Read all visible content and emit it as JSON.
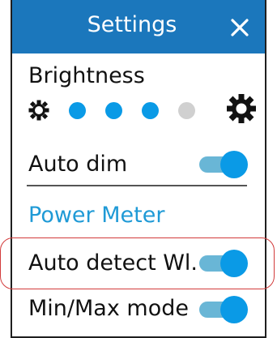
{
  "header": {
    "title": "Settings",
    "close_icon": "close-icon"
  },
  "brightness": {
    "label": "Brightness",
    "min_icon": "sun-small-icon",
    "max_icon": "sun-large-icon",
    "level": 3,
    "max_level": 4
  },
  "auto_dim": {
    "label": "Auto dim",
    "enabled": true
  },
  "section": {
    "power_meter": "Power Meter"
  },
  "auto_detect": {
    "label": "Auto detect Wl.",
    "enabled": true
  },
  "min_max": {
    "label": "Min/Max mode",
    "enabled": true
  },
  "colors": {
    "header_bg": "#1b77bc",
    "accent": "#1f9ad6",
    "toggle_track": "#69b6d6",
    "toggle_knob": "#0a9ae6",
    "dot_inactive": "#d0d0d0",
    "highlight": "#d23b3b"
  }
}
